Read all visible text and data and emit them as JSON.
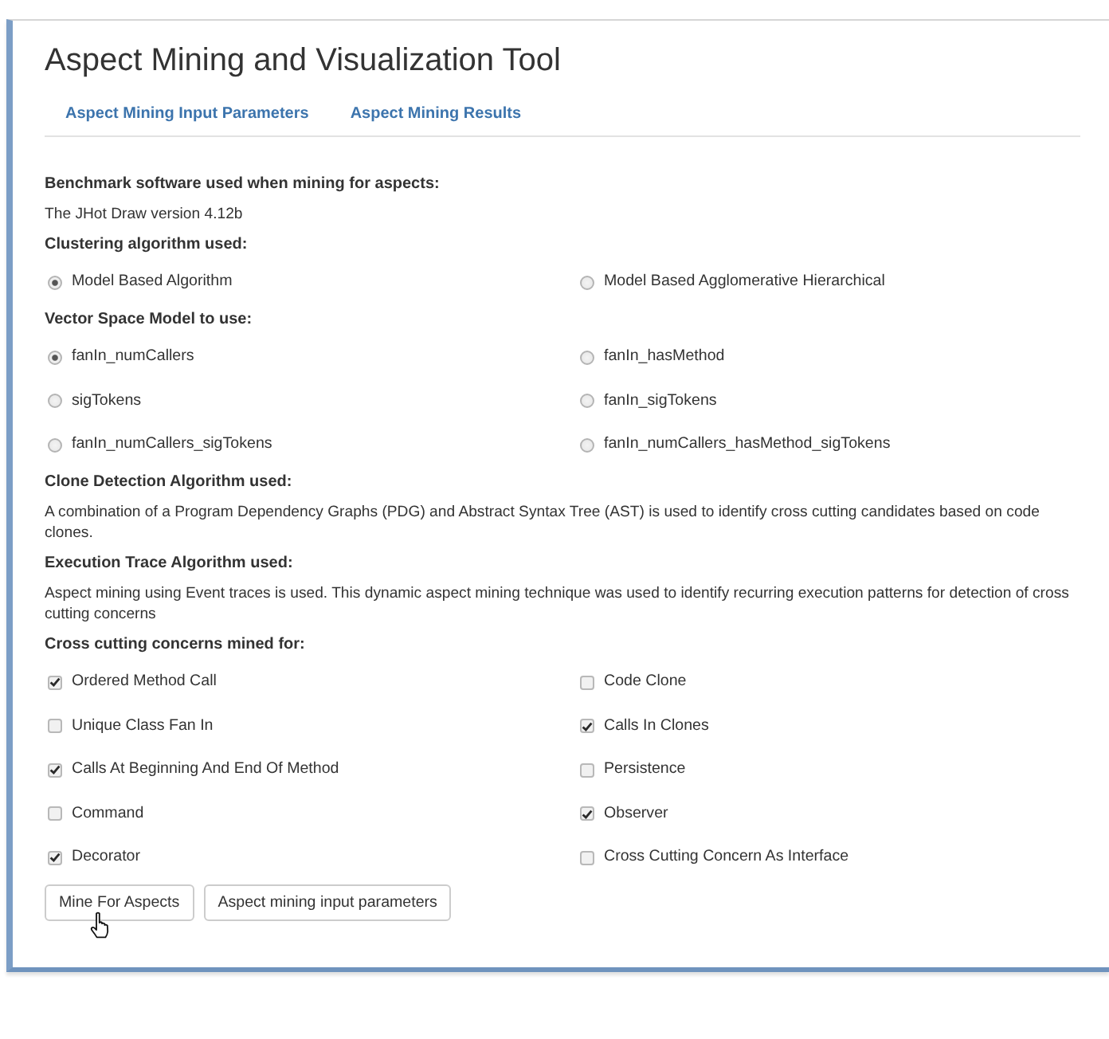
{
  "window": {
    "title": "Aspect Mining and Visualization Tool"
  },
  "tabs": [
    {
      "label": "Aspect Mining Input Parameters",
      "selected": false
    },
    {
      "label": "Aspect Mining Results",
      "selected": false
    }
  ],
  "sections": [
    {
      "kind": "text",
      "heading": "Benchmark software used when mining for aspects:",
      "text": "The JHot Draw version 4.12b"
    },
    {
      "kind": "radio",
      "heading": "Clustering algorithm used:",
      "options": [
        {
          "label": "Model Based Algorithm",
          "selected": true
        },
        {
          "label": "Model Based Agglomerative Hierarchical",
          "selected": false
        }
      ]
    },
    {
      "kind": "radio",
      "heading": "Vector Space Model to use:",
      "options": [
        {
          "label": "fanIn_numCallers",
          "selected": true
        },
        {
          "label": "fanIn_hasMethod",
          "selected": false
        },
        {
          "label": "sigTokens",
          "selected": false
        },
        {
          "label": "fanIn_sigTokens",
          "selected": false
        },
        {
          "label": "fanIn_numCallers_sigTokens",
          "selected": false
        },
        {
          "label": "fanIn_numCallers_hasMethod_sigTokens",
          "selected": false
        }
      ]
    },
    {
      "kind": "text",
      "heading": "Clone Detection Algorithm used:",
      "text": "A combination of a Program Dependency Graphs (PDG) and Abstract Syntax Tree (AST) is used to identify cross cutting candidates based on code clones."
    },
    {
      "kind": "text",
      "heading": "Execution Trace Algorithm used:",
      "text": "Aspect mining using Event traces is used. This dynamic aspect mining technique was used to identify recurring execution patterns for detection of cross cutting concerns"
    },
    {
      "kind": "checkbox",
      "heading": "Cross cutting concerns mined for:",
      "options": [
        {
          "label": "Ordered Method Call",
          "checked": true
        },
        {
          "label": "Code Clone",
          "checked": false
        },
        {
          "label": "Unique Class Fan In",
          "checked": false
        },
        {
          "label": "Calls In Clones",
          "checked": true
        },
        {
          "label": "Calls At Beginning And End Of Method",
          "checked": true
        },
        {
          "label": "Persistence",
          "checked": false
        },
        {
          "label": "Command",
          "checked": false
        },
        {
          "label": "Observer",
          "checked": true
        },
        {
          "label": "Decorator",
          "checked": true
        },
        {
          "label": "Cross Cutting Concern As Interface",
          "checked": false
        }
      ]
    }
  ],
  "buttons": [
    "Mine For Aspects",
    "Aspect mining input parameters"
  ]
}
